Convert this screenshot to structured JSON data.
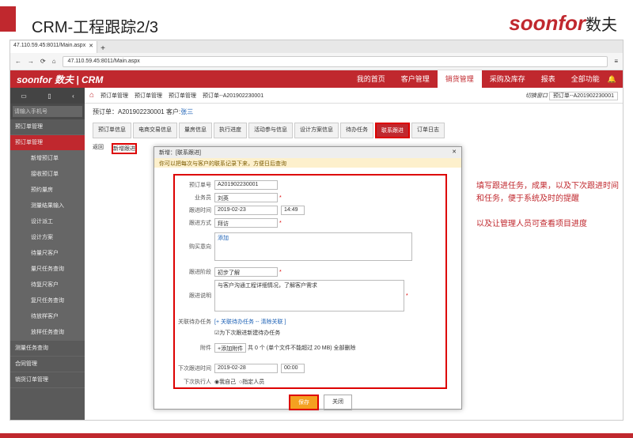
{
  "slide": {
    "title": "CRM-工程跟踪2/3",
    "logo": "soonfor",
    "logo_cn": "数夫"
  },
  "browser": {
    "tab": "47.110.59.45:8011/Main.aspx",
    "url": "47.110.59.45:8011/Main.aspx"
  },
  "appnav": {
    "brand": "soonfor 数夫 | CRM",
    "items": [
      "我的首页",
      "客户管理",
      "销货管理",
      "采购及库存",
      "报表",
      "全部功能"
    ]
  },
  "sidebar": {
    "search": "请输入手机号",
    "items": [
      "预订单管理",
      "预订单管理",
      "新增预订单",
      "接收预订单",
      "预约量房",
      "测量结果输入",
      "设计派工",
      "设计方案",
      "待量尺客户",
      "量尺任务查询",
      "待复尺客户",
      "复尺任务查询",
      "待放样客户",
      "放样任务查询",
      "测量任务查询",
      "合同管理",
      "销货订单管理"
    ]
  },
  "crumbs": {
    "items": [
      "预订单管理",
      "预订单管理",
      "预订单管理",
      "预订单--A201902230001"
    ],
    "switch_label": "切换窗口",
    "switch_value": "预订单--A201902230001"
  },
  "order": {
    "label": "预订单：A201902230001",
    "cust_label": "客户:",
    "cust": "张三"
  },
  "tabs": [
    "预订单信息",
    "电商交易信息",
    "量房信息",
    "执行进度",
    "活动参与信息",
    "设计方案信息",
    "待办任务",
    "联系跟进",
    "订单日志"
  ],
  "toolbar": {
    "back": "返回",
    "new": "新增跟进"
  },
  "dialog": {
    "title": "新增：[联系跟进]",
    "note": "你可以把每次与客户的联系记录下来，方便日后查询",
    "order_no_lbl": "预订单号",
    "order_no": "A201902230001",
    "staff_lbl": "业务员",
    "staff": "刘英",
    "time_lbl": "跟进时间",
    "date": "2019-02-23",
    "time": "14:49",
    "method_lbl": "跟进方式",
    "method": "拜访",
    "purchase_lbl": "购买意向",
    "add": "添加",
    "stage_lbl": "跟进阶段",
    "stage": "初步了解",
    "desc_lbl": "跟进说明",
    "desc": "与客户沟通工程详细情况，了解客户需求",
    "task_lbl": "关联待办任务",
    "task_link": "[+ 关联待办任务 -- 清除关联 ]",
    "task_chk": "为下次跟进新建待办任务",
    "attach_lbl": "附件",
    "attach_btn": "+添加附件",
    "attach_info": "共 0 个 (单个文件不能超过 20 MB) 全部删除",
    "next_lbl": "下次跟进时间",
    "next_date": "2019-02-28",
    "next_time": "00:00",
    "exec_lbl": "下次执行人",
    "exec1": "我自己",
    "exec2": "指定人员",
    "save": "保存",
    "close": "关闭"
  },
  "annot": {
    "line1": "填写跟进任务，成果，以及下次跟进时间和任务，便于系统及时的提醒",
    "line2": "以及让管理人员可查看项目进度"
  }
}
